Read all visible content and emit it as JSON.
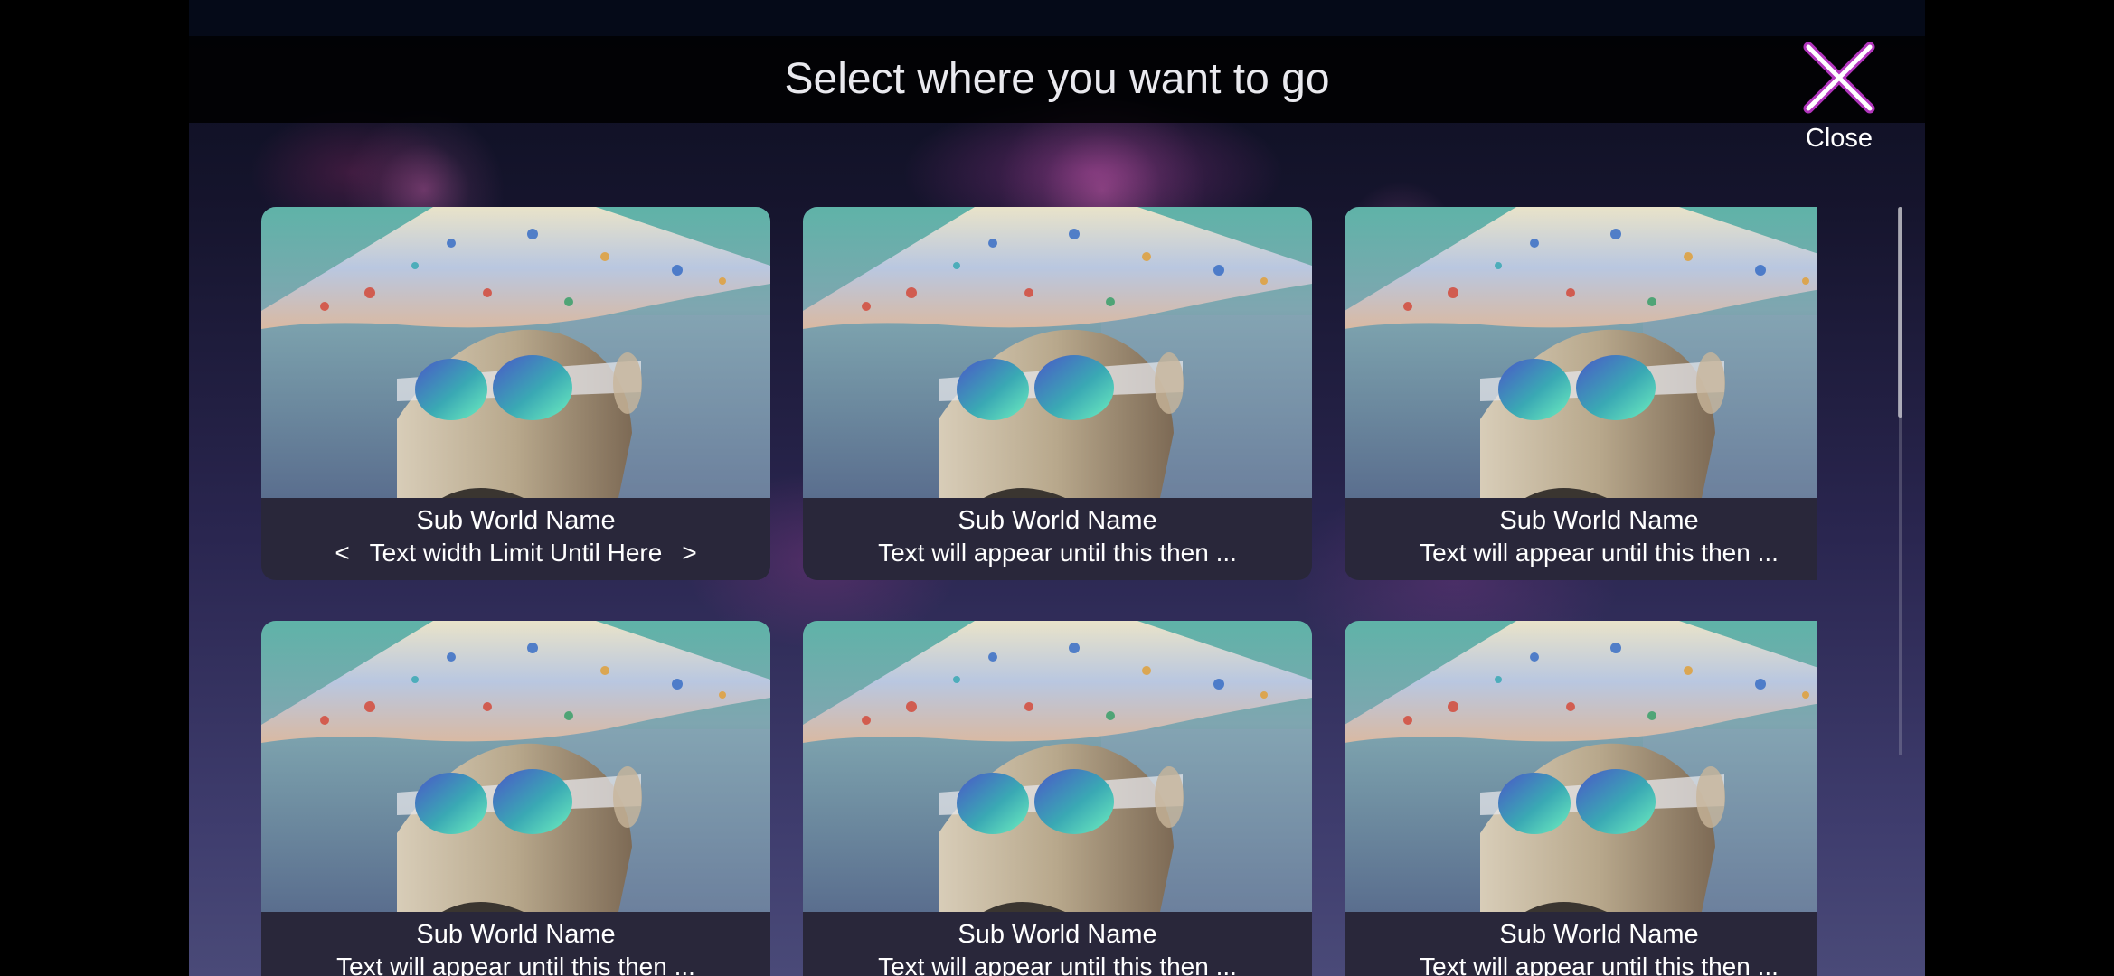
{
  "header": {
    "title": "Select where you want to go",
    "close_label": "Close",
    "close_icon": "close-x-icon"
  },
  "colors": {
    "close_glow": "#c63bd1",
    "title_text": "#e9e9ee",
    "caption_bg": "#28263a"
  },
  "scrollbar": {
    "position": 0
  },
  "cards": [
    {
      "name": "Sub World Name",
      "description": "Text width Limit Until Here",
      "prev": "<",
      "next": ">",
      "thumbnail_icon": "robot-conical-hat-sunglasses-image"
    },
    {
      "name": "Sub World Name",
      "description": "Text will appear until this then ...",
      "thumbnail_icon": "robot-conical-hat-sunglasses-image"
    },
    {
      "name": "Sub World Name",
      "description": "Text will appear until this then ...",
      "thumbnail_icon": "robot-conical-hat-sunglasses-image"
    },
    {
      "name": "Sub World Name",
      "description": "Text will appear until this then ...",
      "thumbnail_icon": "robot-conical-hat-sunglasses-image"
    },
    {
      "name": "Sub World Name",
      "description": "Text will appear until this then ...",
      "thumbnail_icon": "robot-conical-hat-sunglasses-image"
    },
    {
      "name": "Sub World Name",
      "description": "Text will appear until this then ...",
      "thumbnail_icon": "robot-conical-hat-sunglasses-image"
    }
  ]
}
